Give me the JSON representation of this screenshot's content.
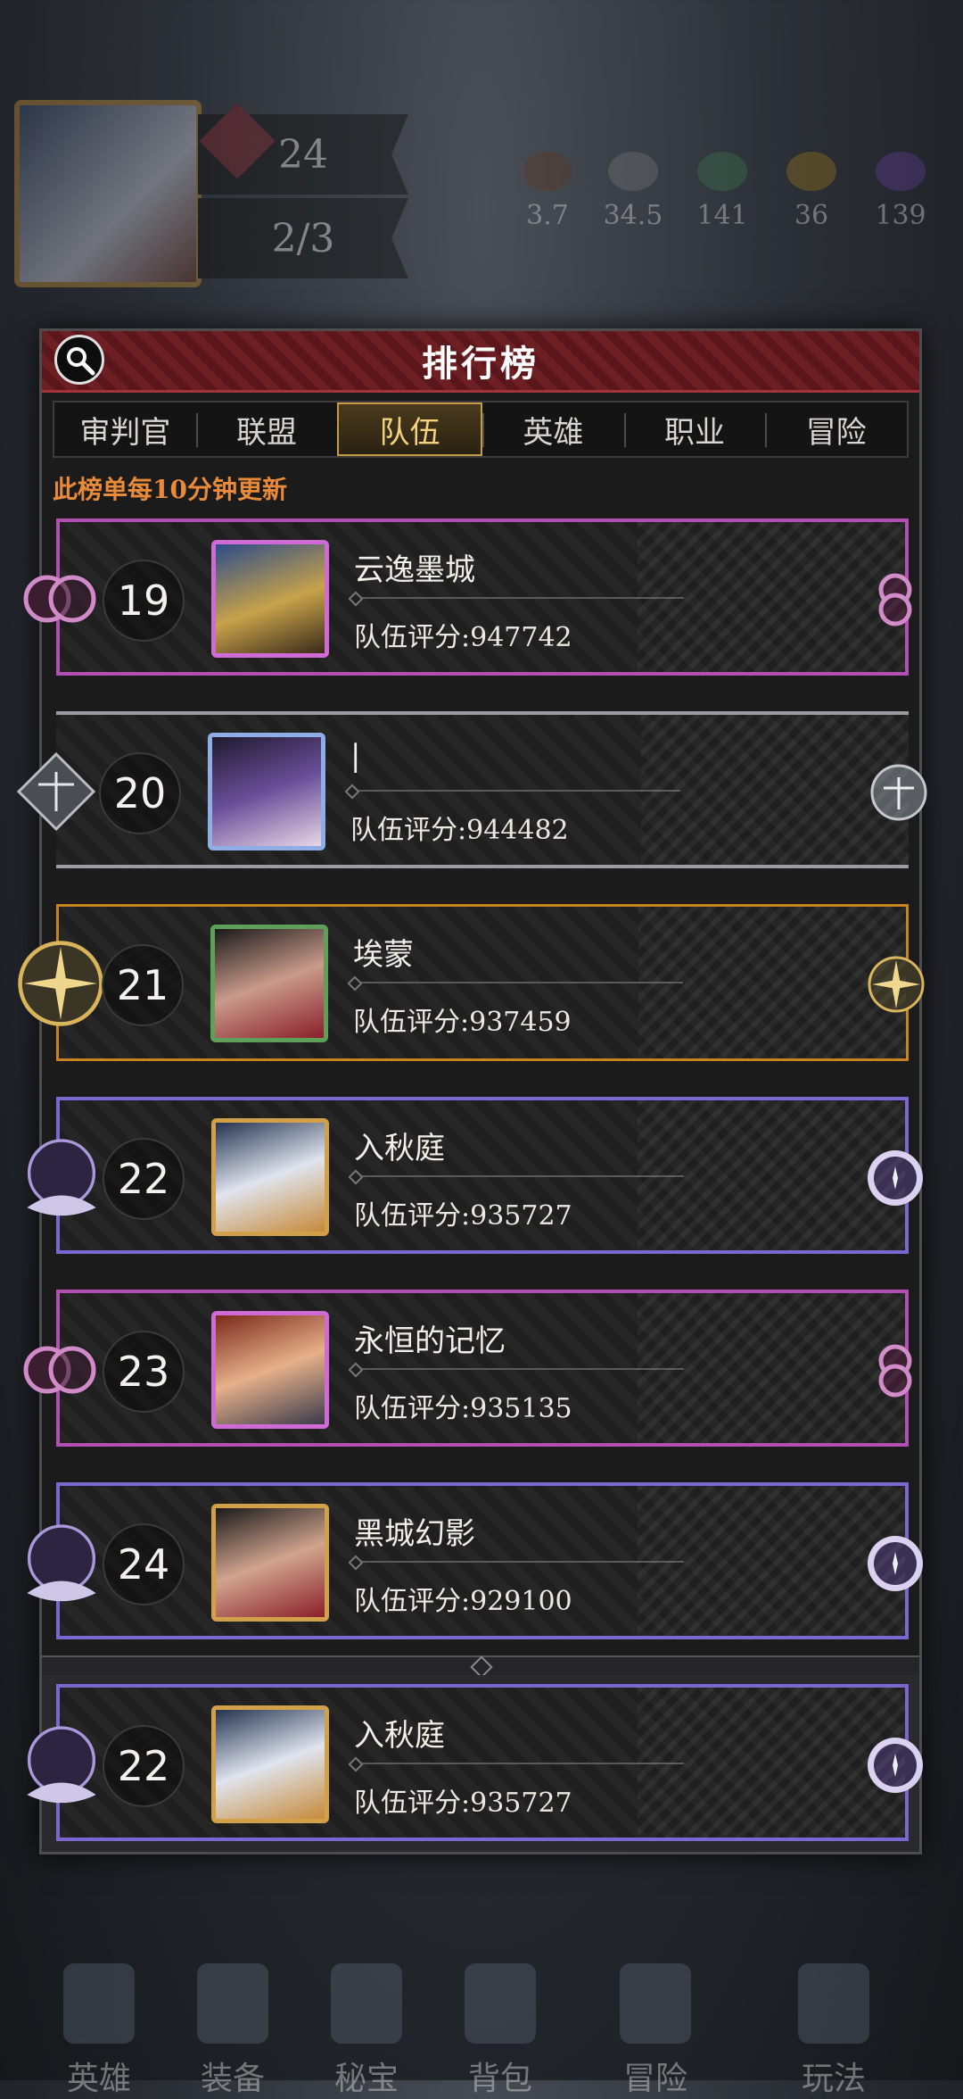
{
  "hud": {
    "level": "24",
    "energy": "2/3",
    "resources": [
      "3.7",
      "34.5",
      "141",
      "36",
      "139"
    ],
    "nav": [
      "英雄",
      "装备",
      "秘宝",
      "背包",
      "冒险",
      "玩法"
    ]
  },
  "leaderboard": {
    "title": "排行榜",
    "tabs": [
      "审判官",
      "联盟",
      "队伍",
      "英雄",
      "职业",
      "冒险"
    ],
    "active_tab": "队伍",
    "update_note": "此榜单每10分钟更新",
    "score_label": "队伍评分:",
    "rows": [
      {
        "rank": "19",
        "name": "云逸墨城",
        "score": "947742"
      },
      {
        "rank": "20",
        "name": "|",
        "score": "944482"
      },
      {
        "rank": "21",
        "name": "埃蒙",
        "score": "937459"
      },
      {
        "rank": "22",
        "name": "入秋庭",
        "score": "935727"
      },
      {
        "rank": "23",
        "name": "永恒的记忆",
        "score": "935135"
      },
      {
        "rank": "24",
        "name": "黑城幻影",
        "score": "929100"
      }
    ],
    "self_row": {
      "rank": "22",
      "name": "入秋庭",
      "score": "935727"
    }
  },
  "colors": {
    "accent_gold": "#c79a45",
    "note_orange": "#e88a3a",
    "header_red": "#6e1f24",
    "frame_pink": "#b34fb3",
    "frame_purple": "#7b66d2",
    "frame_gold": "#c78320",
    "frame_silver": "#9a9ea4"
  }
}
